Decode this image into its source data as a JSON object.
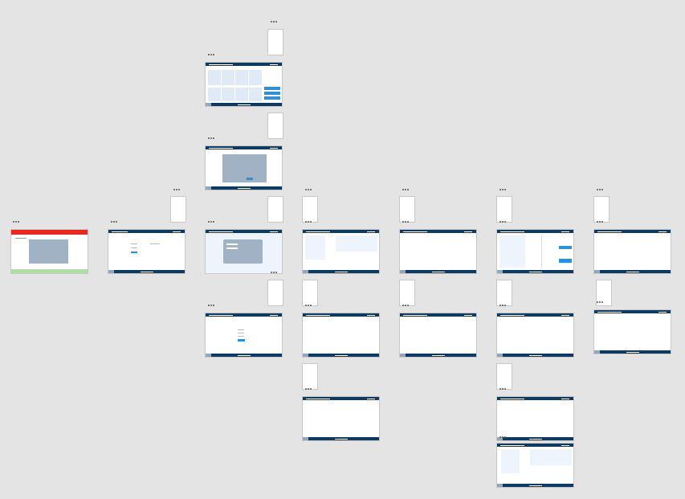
{
  "canvas": {
    "background": "#e4e4e4"
  },
  "colors": {
    "header": "#0d3a63",
    "error_bar": "#e8281e",
    "success_bar": "#a9e29e",
    "panel": "#dfeaf6",
    "dialog": "#a1b2c4",
    "button": "#2f8ed8"
  }
}
